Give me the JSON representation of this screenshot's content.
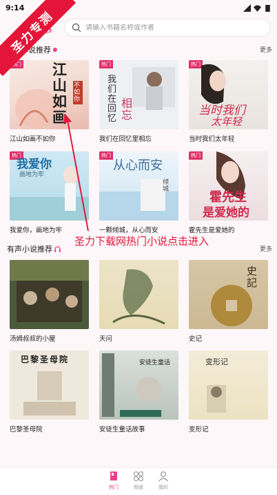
{
  "status": {
    "time": "9:14"
  },
  "header": {
    "title": "书",
    "search_placeholder": "请输入书籍名称或作者"
  },
  "section1": {
    "title": "小说推荐",
    "more": "更多"
  },
  "novels": [
    {
      "title": "江山如画不如你",
      "tag": "热门",
      "cover_text": "江山如画",
      "cover_sub": "不如你"
    },
    {
      "title": "我们在回忆里相忘",
      "tag": "热门",
      "cover_text": "我们在回忆",
      "cover_sub": "相忘"
    },
    {
      "title": "当时我们太年轻",
      "tag": "热门",
      "cover_text": "当时我们",
      "cover_sub": "太年轻"
    },
    {
      "title": "我爱你，画地为牢",
      "tag": "热门",
      "cover_text": "我爱你",
      "cover_sub": "画地为牢"
    },
    {
      "title": "一颗倾城，从心而安",
      "tag": "热门",
      "cover_text": "从心而安",
      "cover_sub": "倾城"
    },
    {
      "title": "霍先生是爱她的",
      "tag": "热门",
      "cover_text": "霍先生",
      "cover_sub": "是爱她的"
    }
  ],
  "annotation": "圣力下载网热门小说点击进入",
  "watermark": "圣力专测",
  "section2": {
    "title": "有声小说推荐",
    "more": "更多"
  },
  "audiobooks": [
    {
      "title": "汤姆叔叔的小屋"
    },
    {
      "title": "天问"
    },
    {
      "title": "史记",
      "cover_text": "史記"
    },
    {
      "title": "巴黎圣母院",
      "cover_text": "巴黎圣母院"
    },
    {
      "title": "安徒生童话故事",
      "cover_text": "安徒生童话"
    },
    {
      "title": "变形记",
      "cover_text": "变形记"
    }
  ],
  "nav": [
    {
      "label": "热门",
      "icon": "book-icon",
      "active": true
    },
    {
      "label": "频道",
      "icon": "grid-icon",
      "active": false
    },
    {
      "label": "我的",
      "icon": "user-icon",
      "active": false
    }
  ],
  "colors": {
    "accent": "#e8448a",
    "watermark": "#e3163a",
    "background": "#fdf7f9"
  }
}
